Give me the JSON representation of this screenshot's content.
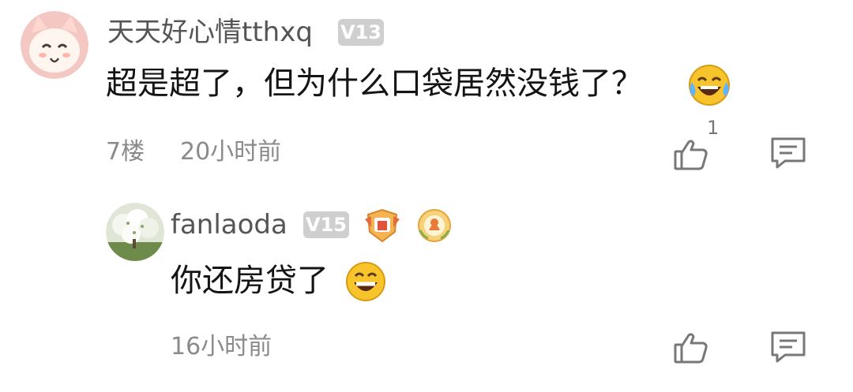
{
  "comment": {
    "username": "天天好心情tthxq",
    "level": "V13",
    "text": "超是超了，但为什么口袋居然没钱了？",
    "emoji": "laughing-tears-emoji",
    "floor": "7楼",
    "time": "20小时前",
    "likes": "1"
  },
  "reply": {
    "username": "fanlaoda",
    "level": "V15",
    "text": "你还房贷了",
    "emoji": "grinning-emoji",
    "time": "16小时前"
  },
  "colors": {
    "username": "#555555",
    "meta": "#8a8a8a",
    "badge": "#cfcfcf"
  }
}
